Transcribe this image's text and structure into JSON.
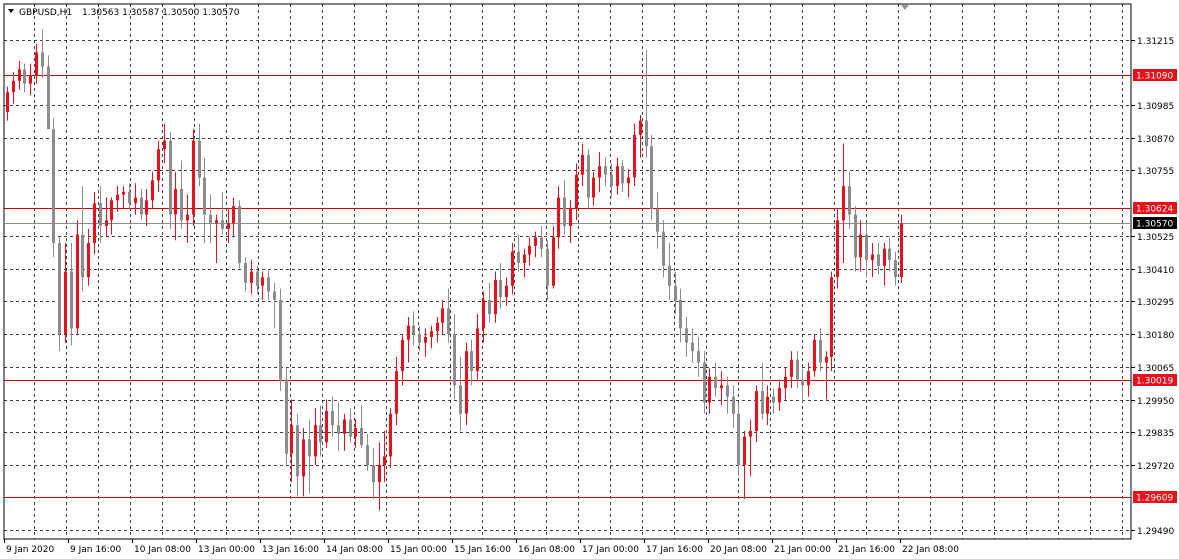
{
  "header": {
    "symbol": "GBPUSD,H1",
    "ohlc": "1.30563 1.30587 1.30500 1.30570"
  },
  "colors": {
    "background": "#ffffff",
    "grid": "#000000",
    "bull": "#e8101a",
    "bear": "#8c8c8c",
    "level_line": "#cc0000",
    "level_tag": "#e8101a",
    "current_tag": "#000000",
    "current_line": "#8c8c8c"
  },
  "chart_data": {
    "type": "candlestick",
    "title": "GBPUSD,H1",
    "ylim": [
      1.2946,
      1.3134
    ],
    "y_ticks": [
      "1.31215",
      "1.30985",
      "1.30870",
      "1.30755",
      "1.30525",
      "1.30410",
      "1.30295",
      "1.30180",
      "1.30065",
      "1.29950",
      "1.29835",
      "1.29720",
      "1.29490"
    ],
    "x_ticks": [
      "9 Jan 2020",
      "9 Jan 16:00",
      "10 Jan 08:00",
      "13 Jan 00:00",
      "13 Jan 16:00",
      "14 Jan 08:00",
      "15 Jan 00:00",
      "15 Jan 16:00",
      "16 Jan 08:00",
      "17 Jan 00:00",
      "17 Jan 16:00",
      "20 Jan 08:00",
      "21 Jan 00:00",
      "21 Jan 16:00",
      "22 Jan 08:00"
    ],
    "grid": true,
    "levels": [
      "1.31090",
      "1.30624",
      "1.30019",
      "1.29609"
    ],
    "current_price": "1.30570",
    "candles": [
      [
        1.3096,
        1.3105,
        1.3093,
        1.3103
      ],
      [
        1.3103,
        1.311,
        1.3099,
        1.3107
      ],
      [
        1.3107,
        1.3114,
        1.3104,
        1.3111
      ],
      [
        1.3111,
        1.3113,
        1.3103,
        1.3106
      ],
      [
        1.3106,
        1.3113,
        1.3102,
        1.3109
      ],
      [
        1.3109,
        1.312,
        1.3106,
        1.3117
      ],
      [
        1.3117,
        1.3125,
        1.3108,
        1.3112
      ],
      [
        1.3112,
        1.3116,
        1.3096,
        1.309
      ],
      [
        1.309,
        1.3094,
        1.3045,
        1.305
      ],
      [
        1.305,
        1.3052,
        1.3012,
        1.3018
      ],
      [
        1.3018,
        1.305,
        1.3015,
        1.304
      ],
      [
        1.304,
        1.305,
        1.3014,
        1.302
      ],
      [
        1.302,
        1.3058,
        1.3018,
        1.3053
      ],
      [
        1.3053,
        1.307,
        1.3033,
        1.3038
      ],
      [
        1.3038,
        1.3055,
        1.3035,
        1.305
      ],
      [
        1.305,
        1.3068,
        1.3046,
        1.3064
      ],
      [
        1.3064,
        1.307,
        1.305,
        1.3056
      ],
      [
        1.3056,
        1.3066,
        1.3052,
        1.3058
      ],
      [
        1.3058,
        1.3066,
        1.3053,
        1.3065
      ],
      [
        1.3065,
        1.307,
        1.3061,
        1.3067
      ],
      [
        1.3067,
        1.307,
        1.3062,
        1.3068
      ],
      [
        1.3068,
        1.3071,
        1.3062,
        1.3064
      ],
      [
        1.3064,
        1.3071,
        1.306,
        1.3066
      ],
      [
        1.3066,
        1.3069,
        1.3058,
        1.306
      ],
      [
        1.306,
        1.3069,
        1.3056,
        1.3065
      ],
      [
        1.3065,
        1.3075,
        1.3062,
        1.3072
      ],
      [
        1.3072,
        1.3086,
        1.3068,
        1.3083
      ],
      [
        1.3083,
        1.3092,
        1.3078,
        1.3086
      ],
      [
        1.3086,
        1.3089,
        1.3055,
        1.306
      ],
      [
        1.306,
        1.3075,
        1.3051,
        1.3069
      ],
      [
        1.3069,
        1.3079,
        1.3055,
        1.3058
      ],
      [
        1.3058,
        1.3067,
        1.305,
        1.306
      ],
      [
        1.306,
        1.309,
        1.3056,
        1.3086
      ],
      [
        1.3086,
        1.3092,
        1.307,
        1.3073
      ],
      [
        1.3073,
        1.308,
        1.305,
        1.306
      ],
      [
        1.306,
        1.3067,
        1.305,
        1.3057
      ],
      [
        1.3057,
        1.306,
        1.3043,
        1.3058
      ],
      [
        1.3058,
        1.3068,
        1.3053,
        1.3055
      ],
      [
        1.3055,
        1.3062,
        1.305,
        1.3057
      ],
      [
        1.3057,
        1.3066,
        1.3052,
        1.3063
      ],
      [
        1.3063,
        1.3065,
        1.3041,
        1.3043
      ],
      [
        1.3043,
        1.3045,
        1.3033,
        1.3036
      ],
      [
        1.3036,
        1.3044,
        1.3032,
        1.304
      ],
      [
        1.304,
        1.3042,
        1.3032,
        1.3035
      ],
      [
        1.3035,
        1.304,
        1.303,
        1.3038
      ],
      [
        1.3038,
        1.3041,
        1.303,
        1.3033
      ],
      [
        1.3033,
        1.3036,
        1.302,
        1.303
      ],
      [
        1.303,
        1.3034,
        1.2998,
        1.3002
      ],
      [
        1.3002,
        1.3006,
        1.2972,
        1.2976
      ],
      [
        1.2976,
        1.2995,
        1.2966,
        1.2986
      ],
      [
        1.2986,
        1.299,
        1.2961,
        1.2968
      ],
      [
        1.2968,
        1.2985,
        1.2961,
        1.2981
      ],
      [
        1.2981,
        1.2988,
        1.2962,
        1.2975
      ],
      [
        1.2975,
        1.2992,
        1.2972,
        1.2986
      ],
      [
        1.2986,
        1.2993,
        1.2975,
        1.298
      ],
      [
        1.298,
        1.2995,
        1.2978,
        1.2991
      ],
      [
        1.2991,
        1.2996,
        1.2982,
        1.2986
      ],
      [
        1.2986,
        1.2994,
        1.2977,
        1.2983
      ],
      [
        1.2983,
        1.299,
        1.2977,
        1.2988
      ],
      [
        1.2988,
        1.2992,
        1.298,
        1.2982
      ],
      [
        1.2982,
        1.2988,
        1.2978,
        1.2985
      ],
      [
        1.2985,
        1.2993,
        1.2978,
        1.2979
      ],
      [
        1.2979,
        1.2983,
        1.297,
        1.2972
      ],
      [
        1.2972,
        1.2978,
        1.296,
        1.2966
      ],
      [
        1.2966,
        1.298,
        1.2956,
        1.2972
      ],
      [
        1.2972,
        1.2984,
        1.2966,
        1.2975
      ],
      [
        1.2975,
        1.2992,
        1.2971,
        1.299
      ],
      [
        1.299,
        1.301,
        1.2986,
        1.3005
      ],
      [
        1.3005,
        1.3018,
        1.3,
        1.3016
      ],
      [
        1.3016,
        1.3024,
        1.3008,
        1.3021
      ],
      [
        1.3021,
        1.3026,
        1.3014,
        1.3018
      ],
      [
        1.3018,
        1.3021,
        1.3012,
        1.3015
      ],
      [
        1.3015,
        1.302,
        1.301,
        1.3017
      ],
      [
        1.3017,
        1.3021,
        1.3013,
        1.3019
      ],
      [
        1.3019,
        1.3024,
        1.3015,
        1.3022
      ],
      [
        1.3022,
        1.303,
        1.3018,
        1.3027
      ],
      [
        1.3027,
        1.3034,
        1.3015,
        1.3018
      ],
      [
        1.3018,
        1.3025,
        1.2995,
        1.3
      ],
      [
        1.3,
        1.301,
        1.2984,
        1.299
      ],
      [
        1.299,
        1.3015,
        1.2986,
        1.3012
      ],
      [
        1.3012,
        1.3016,
        1.3,
        1.3005
      ],
      [
        1.3005,
        1.3025,
        1.3002,
        1.302
      ],
      [
        1.302,
        1.3033,
        1.3015,
        1.303
      ],
      [
        1.303,
        1.3036,
        1.3022,
        1.3025
      ],
      [
        1.3025,
        1.304,
        1.3022,
        1.3037
      ],
      [
        1.3037,
        1.3043,
        1.3027,
        1.3031
      ],
      [
        1.3031,
        1.3038,
        1.3028,
        1.3035
      ],
      [
        1.3035,
        1.305,
        1.3032,
        1.3047
      ],
      [
        1.3047,
        1.3053,
        1.304,
        1.3043
      ],
      [
        1.3043,
        1.3048,
        1.3038,
        1.3046
      ],
      [
        1.3046,
        1.3052,
        1.3042,
        1.3049
      ],
      [
        1.3049,
        1.3054,
        1.3045,
        1.3052
      ],
      [
        1.3052,
        1.3056,
        1.3045,
        1.3048
      ],
      [
        1.3048,
        1.3051,
        1.303,
        1.3035
      ],
      [
        1.3035,
        1.3056,
        1.3034,
        1.3052
      ],
      [
        1.3052,
        1.307,
        1.3048,
        1.3066
      ],
      [
        1.3066,
        1.3072,
        1.3053,
        1.3056
      ],
      [
        1.3056,
        1.3065,
        1.305,
        1.3062
      ],
      [
        1.3062,
        1.3078,
        1.3058,
        1.3074
      ],
      [
        1.3074,
        1.3085,
        1.307,
        1.3081
      ],
      [
        1.3081,
        1.3083,
        1.3062,
        1.3066
      ],
      [
        1.3066,
        1.3075,
        1.3063,
        1.3073
      ],
      [
        1.3073,
        1.3082,
        1.3068,
        1.3077
      ],
      [
        1.3077,
        1.308,
        1.307,
        1.3074
      ],
      [
        1.3074,
        1.3078,
        1.3066,
        1.307
      ],
      [
        1.307,
        1.308,
        1.3067,
        1.3077
      ],
      [
        1.3077,
        1.3079,
        1.3068,
        1.3071
      ],
      [
        1.3071,
        1.3076,
        1.3066,
        1.3073
      ],
      [
        1.3073,
        1.3092,
        1.307,
        1.3088
      ],
      [
        1.3088,
        1.3095,
        1.308,
        1.3093
      ],
      [
        1.3093,
        1.3118,
        1.308,
        1.3084
      ],
      [
        1.3084,
        1.3088,
        1.3058,
        1.3062
      ],
      [
        1.3062,
        1.3068,
        1.3048,
        1.3054
      ],
      [
        1.3054,
        1.3058,
        1.3038,
        1.3042
      ],
      [
        1.3042,
        1.305,
        1.303,
        1.3035
      ],
      [
        1.3035,
        1.304,
        1.3025,
        1.303
      ],
      [
        1.303,
        1.3034,
        1.3015,
        1.302
      ],
      [
        1.302,
        1.3024,
        1.301,
        1.3015
      ],
      [
        1.3015,
        1.302,
        1.3008,
        1.3012
      ],
      [
        1.3012,
        1.3017,
        1.3003,
        1.3008
      ],
      [
        1.3008,
        1.3012,
        1.299,
        1.2994
      ],
      [
        1.2994,
        1.3006,
        1.299,
        1.3003
      ],
      [
        1.3003,
        1.3008,
        1.2996,
        1.2999
      ],
      [
        1.2999,
        1.3005,
        1.2993,
        1.3
      ],
      [
        1.3,
        1.3003,
        1.299,
        1.2996
      ],
      [
        1.2996,
        1.3,
        1.2985,
        1.299
      ],
      [
        1.299,
        1.2994,
        1.2968,
        1.2972
      ],
      [
        1.2972,
        1.2984,
        1.296,
        1.2982
      ],
      [
        1.2982,
        1.2988,
        1.2968,
        1.2984
      ],
      [
        1.2984,
        1.3,
        1.298,
        1.2998
      ],
      [
        1.2998,
        1.3008,
        1.2988,
        1.299
      ],
      [
        1.299,
        1.3,
        1.2986,
        1.2996
      ],
      [
        1.2996,
        1.2999,
        1.299,
        1.2994
      ],
      [
        1.2994,
        1.3002,
        1.2991,
        1.2999
      ],
      [
        1.2999,
        1.3006,
        1.2995,
        1.3003
      ],
      [
        1.3003,
        1.3012,
        1.2999,
        1.3009
      ],
      [
        1.3009,
        1.3012,
        1.2999,
        1.3002
      ],
      [
        1.3002,
        1.3006,
        1.2994,
        1.3
      ],
      [
        1.3,
        1.3008,
        1.2996,
        1.3005
      ],
      [
        1.3005,
        1.3018,
        1.3003,
        1.3016
      ],
      [
        1.3016,
        1.302,
        1.3005,
        1.3008
      ],
      [
        1.3008,
        1.3012,
        1.2995,
        1.301
      ],
      [
        1.301,
        1.304,
        1.3005,
        1.3038
      ],
      [
        1.3038,
        1.3062,
        1.3034,
        1.3058
      ],
      [
        1.3058,
        1.3085,
        1.3043,
        1.307
      ],
      [
        1.307,
        1.3075,
        1.3055,
        1.306
      ],
      [
        1.306,
        1.3063,
        1.304,
        1.3045
      ],
      [
        1.3045,
        1.3058,
        1.304,
        1.3053
      ],
      [
        1.3053,
        1.3057,
        1.3038,
        1.3044
      ],
      [
        1.3044,
        1.305,
        1.3038,
        1.3046
      ],
      [
        1.3046,
        1.305,
        1.3039,
        1.3042
      ],
      [
        1.3042,
        1.305,
        1.3035,
        1.3048
      ],
      [
        1.3048,
        1.3052,
        1.304,
        1.3044
      ],
      [
        1.3044,
        1.3047,
        1.3035,
        1.3038
      ],
      [
        1.3038,
        1.306,
        1.3036,
        1.3057
      ]
    ]
  }
}
